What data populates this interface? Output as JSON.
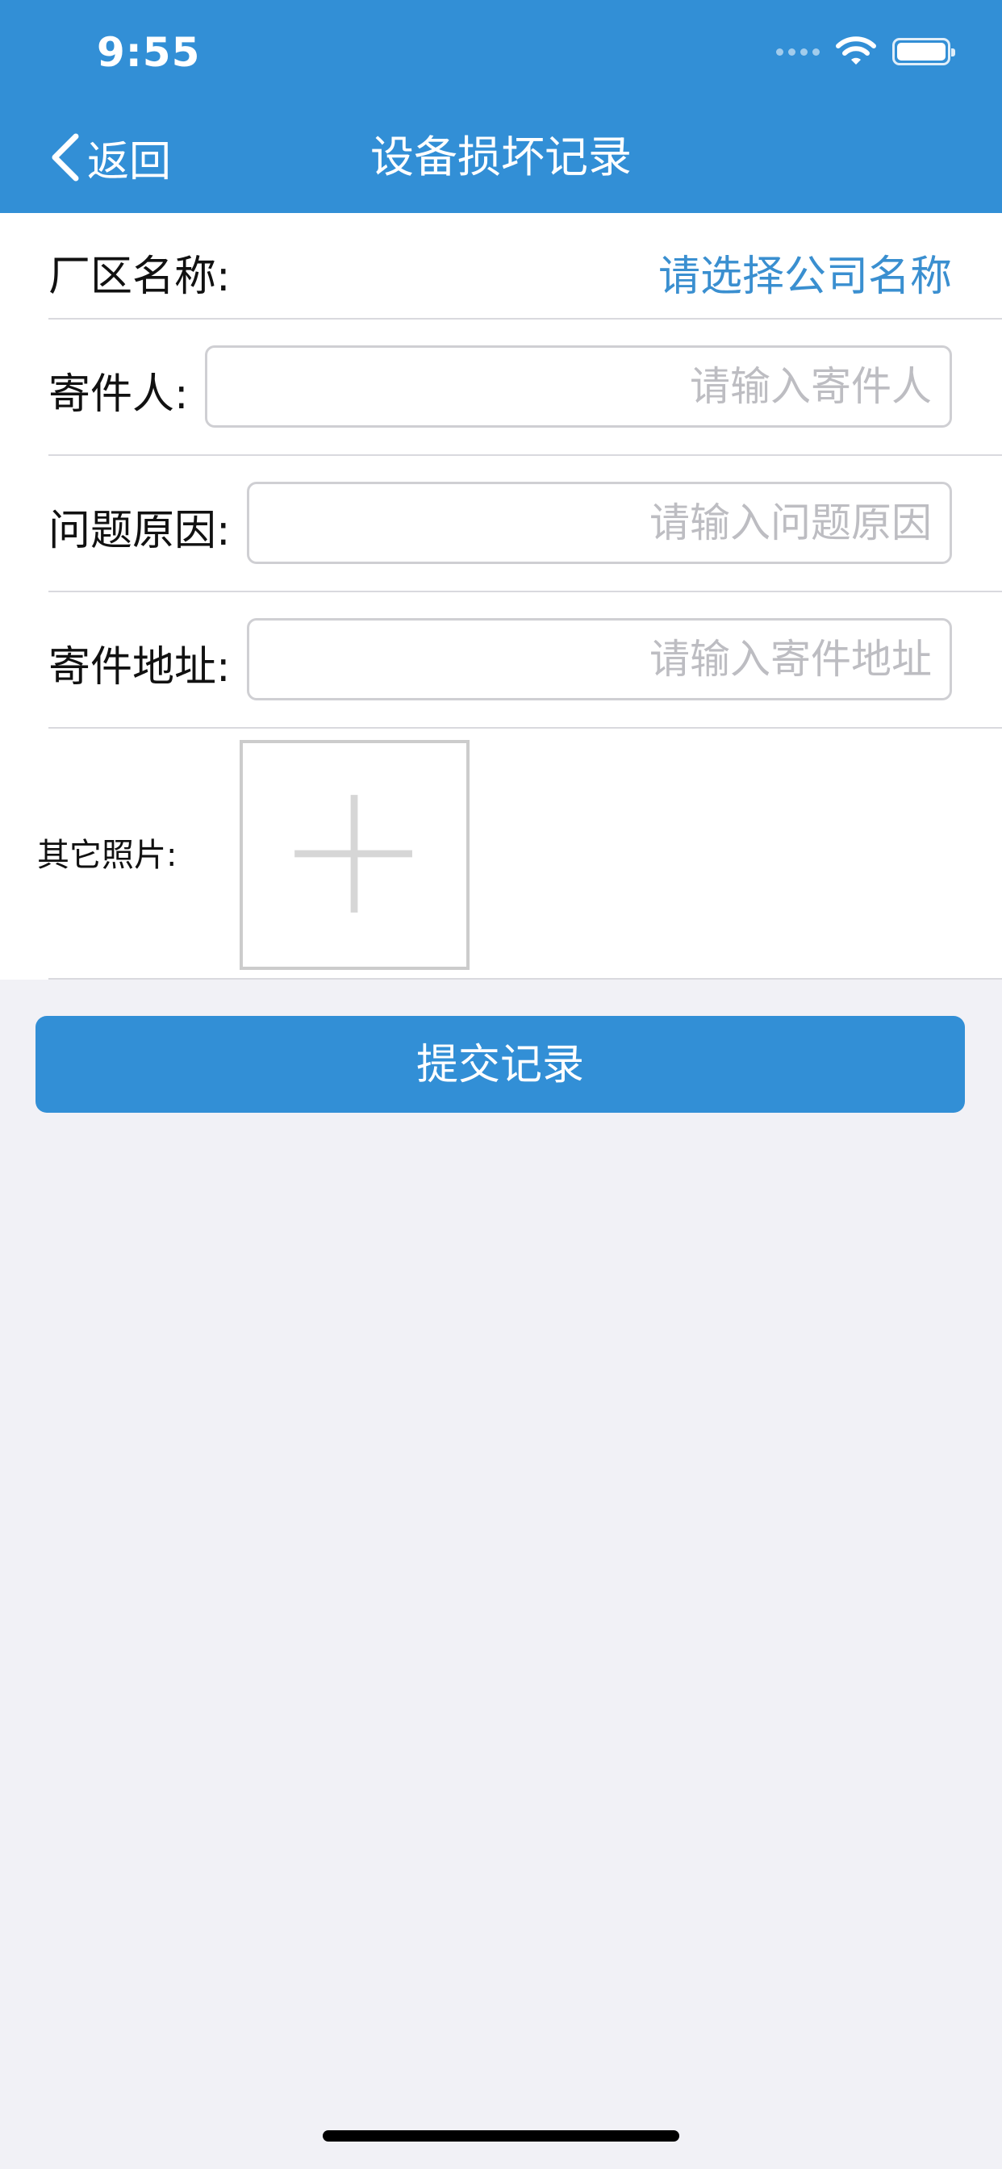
{
  "status_bar": {
    "time": "9:55"
  },
  "nav": {
    "back_label": "返回",
    "title": "设备损坏记录"
  },
  "form": {
    "factory": {
      "label": "厂区名称:",
      "value": "请选择公司名称"
    },
    "sender": {
      "label": "寄件人:",
      "placeholder": "请输入寄件人",
      "value": ""
    },
    "reason": {
      "label": "问题原因:",
      "placeholder": "请输入问题原因",
      "value": ""
    },
    "address": {
      "label": "寄件地址:",
      "placeholder": "请输入寄件地址",
      "value": ""
    },
    "photos": {
      "label": "其它照片:"
    }
  },
  "submit": {
    "label": "提交记录"
  },
  "colors": {
    "accent": "#328fd6",
    "link": "#3a8fd0",
    "background": "#f1f1f6",
    "placeholder": "#bdbdc2"
  },
  "icons": {
    "back": "chevron-left-icon",
    "wifi": "wifi-icon",
    "battery": "battery-icon",
    "add_photo": "plus-icon"
  }
}
